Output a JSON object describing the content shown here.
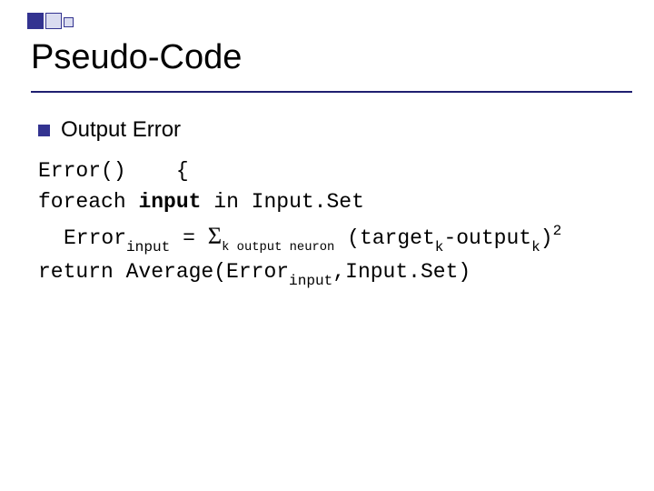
{
  "title": "Pseudo-Code",
  "bullet1": "Output Error",
  "code": {
    "l1a": "Error()",
    "l1b": "{",
    "l2a": "foreach",
    "l2b": "input",
    "l2c": "in Input.Set",
    "l3a": "Error",
    "l3sub1": "input",
    "l3eq": " = ",
    "l3sigma": "Σ",
    "l3sigmasub": "k output neuron",
    "l3b": " (target",
    "l3sub2": "k",
    "l3dash": "-",
    "l3c": "output",
    "l3sub3": "k",
    "l3paren": ")",
    "l3sup": "2",
    "l4a": "return Average(Error",
    "l4sub": "input",
    "l4b": ",Input.Set)"
  }
}
